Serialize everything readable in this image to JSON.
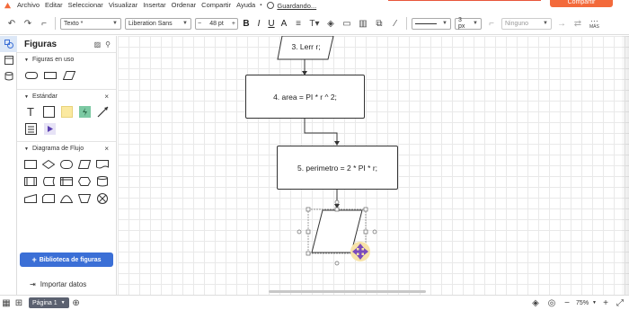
{
  "menu": {
    "items": [
      "Archivo",
      "Editar",
      "Seleccionar",
      "Visualizar",
      "Insertar",
      "Ordenar",
      "Compartir",
      "Ayuda"
    ],
    "save_status": "Guardando...",
    "share_label": "Compartir"
  },
  "toolbar": {
    "style_select": "Texto *",
    "font_select": "Liberation Sans",
    "font_size": "48 pt",
    "bold": "B",
    "italic": "I",
    "underline": "U",
    "text_color": "A",
    "line_width": "3 px",
    "arrow_select": "Ninguno",
    "more_label": "MÁS"
  },
  "panel": {
    "title": "Figuras",
    "sections": [
      {
        "label": "Figuras en uso"
      },
      {
        "label": "Estándar"
      },
      {
        "label": "Diagrama de Flujo"
      }
    ],
    "library_button": "Biblioteca de figuras",
    "import_label": "Importar datos"
  },
  "canvas": {
    "nodes": [
      {
        "label": "3. Lerr r;"
      },
      {
        "label": "4. area = PI * r ^ 2;"
      },
      {
        "label": "5. perimetro = 2 * PI * r;"
      }
    ]
  },
  "bottom": {
    "page_label": "Página 1",
    "zoom": "75%"
  },
  "colors": {
    "accent": "#3b6fd6",
    "share": "#f36a3b",
    "move_handle": "#7b4bbd"
  }
}
